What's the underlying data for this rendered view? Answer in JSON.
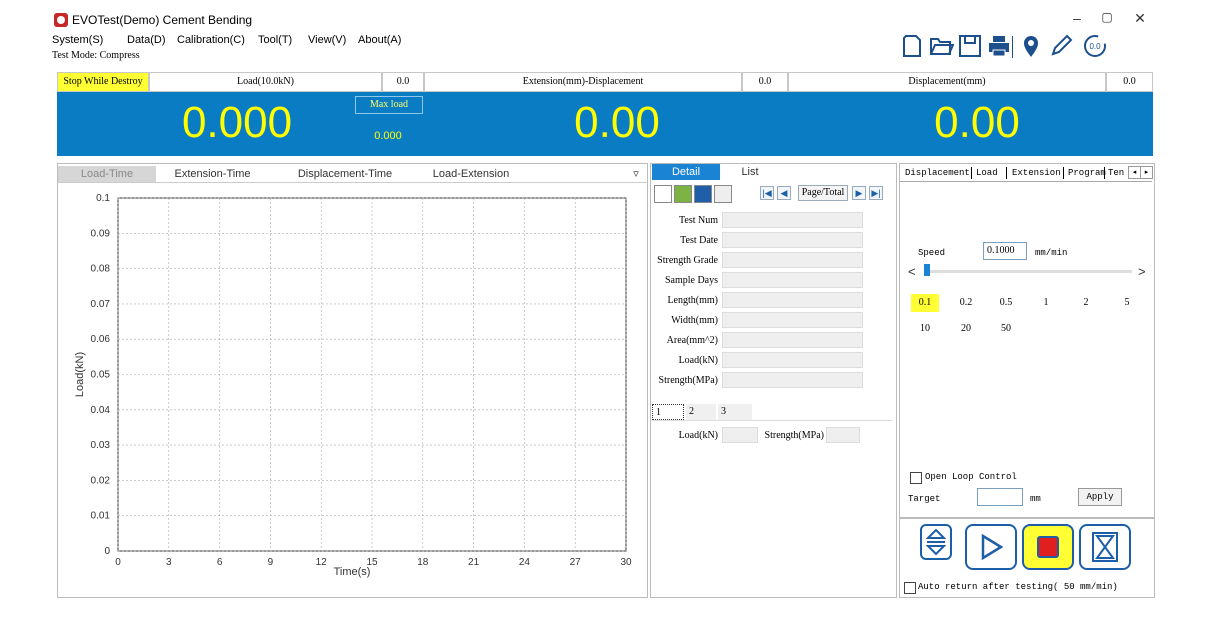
{
  "window": {
    "title": "EVOTest(Demo) Cement Bending",
    "minimize": "–",
    "maximize": "▢",
    "close": "✕"
  },
  "menu": [
    "System(S)",
    "Data(D)",
    "Calibration(C)",
    "Tool(T)",
    "View(V)",
    "About(A)"
  ],
  "test_mode": "Test Mode:  Compress",
  "toolbar_icons": [
    "new-icon",
    "open-icon",
    "save-icon",
    "print-icon",
    "location-icon",
    "pencil-icon",
    "zero-icon"
  ],
  "readout": {
    "stop_while_destroy": "Stop While Destroy",
    "load_header": "Load(10.0kN)",
    "load_small": "0.0",
    "ext_header": "Extension(mm)-Displacement",
    "ext_small": "0.0",
    "disp_header": "Displacement(mm)",
    "disp_small": "0.0",
    "load_value": "0.000",
    "max_load_label": "Max load",
    "max_load_value": "0.000",
    "ext_value": "0.00",
    "disp_value": "0.00"
  },
  "chart_tabs": [
    "Load-Time",
    "Extension-Time",
    "Displacement-Time",
    "Load-Extension"
  ],
  "chart_tabs_dropdown": "▿",
  "chart_data": {
    "type": "line",
    "xlabel": "Time(s)",
    "ylabel": "Load(kN)",
    "xlim": [
      0,
      30
    ],
    "ylim": [
      0,
      0.1
    ],
    "x_ticks": [
      "0",
      "3",
      "6",
      "9",
      "12",
      "15",
      "18",
      "21",
      "24",
      "27",
      "30"
    ],
    "y_ticks": [
      "0",
      "0.01",
      "0.02",
      "0.03",
      "0.04",
      "0.05",
      "0.06",
      "0.07",
      "0.08",
      "0.09",
      "0.1"
    ],
    "series": [],
    "grid": true
  },
  "detail": {
    "tab_detail": "Detail",
    "tab_list": "List",
    "page_total": "Page/Total",
    "fields": [
      "Test Num",
      "Test Date",
      "Strength Grade",
      "Sample Days",
      "Length(mm)",
      "Width(mm)",
      "Area(mm^2)",
      "Load(kN)",
      "Strength(MPa)"
    ],
    "sample_tabs": [
      "1",
      "2",
      "3"
    ],
    "sample_load_label": "Load(kN)",
    "sample_strength_label": "Strength(MPa)"
  },
  "right": {
    "tabs": [
      "Displacement",
      "Load",
      "Extension",
      "Program",
      "Ten"
    ],
    "speed_label": "Speed",
    "speed_value": "0.1000",
    "speed_unit": "mm/min",
    "slider_left": "<",
    "slider_right": ">",
    "slider_position": 0.0,
    "speeds_row1": [
      "0.1",
      "0.2",
      "0.5",
      "1",
      "2",
      "5"
    ],
    "speeds_row2": [
      "10",
      "20",
      "50"
    ],
    "selected_speed": "0.1",
    "open_loop": "Open Loop Control",
    "target_label": "Target",
    "target_unit": "mm",
    "apply": "Apply",
    "auto_return": "Auto return after testing( 50  mm/min)"
  },
  "colors": {
    "readout_bg": "#0a7cc4",
    "readout_digits": "#ffff00",
    "highlight": "#ffff33",
    "stop_red": "#e02020",
    "tab_active": "#1a83d4"
  }
}
